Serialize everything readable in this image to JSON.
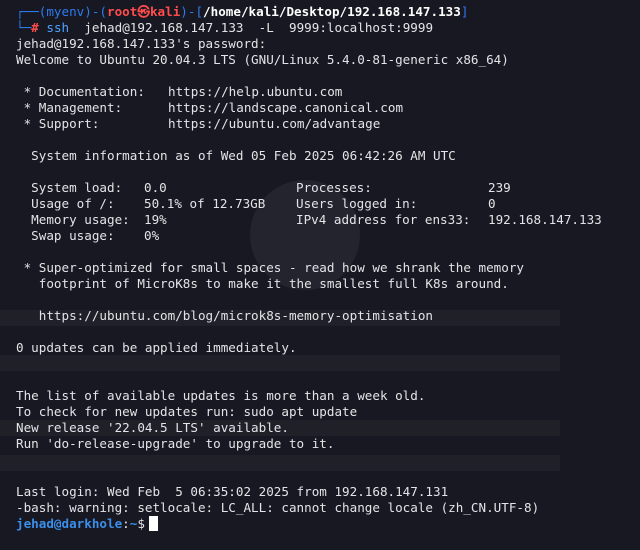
{
  "prompt": {
    "user": "root",
    "host": "kali",
    "skull": "㉿",
    "venv": "myenv",
    "cwd": "/home/kali/Desktop/192.168.147.133",
    "command": "ssh",
    "args": "jehad@192.168.147.133  -L  9999:localhost:9999"
  },
  "output": {
    "password_prompt": "jehad@192.168.147.133's password:",
    "welcome": "Welcome to Ubuntu 20.04.3 LTS (GNU/Linux 5.4.0-81-generic x86_64)",
    "links": [
      {
        "label": " * Documentation:",
        "url": "https://help.ubuntu.com"
      },
      {
        "label": " * Management:",
        "url": "https://landscape.canonical.com"
      },
      {
        "label": " * Support:",
        "url": "https://ubuntu.com/advantage"
      }
    ],
    "sysinfo_title": "  System information as of Wed 05 Feb 2025 06:42:26 AM UTC",
    "sysinfo": [
      {
        "k1": "  System load:",
        "v1": "0.0",
        "k2": "Processes:",
        "v2": "239"
      },
      {
        "k1": "  Usage of /:",
        "v1": "50.1% of 12.73GB",
        "k2": "Users logged in:",
        "v2": "0"
      },
      {
        "k1": "  Memory usage:",
        "v1": "19%",
        "k2": "IPv4 address for ens33:",
        "v2": "192.168.147.133"
      },
      {
        "k1": "  Swap usage:",
        "v1": "0%",
        "k2": "",
        "v2": ""
      }
    ],
    "microk8s_1": " * Super-optimized for small spaces - read how we shrank the memory",
    "microk8s_2": "   footprint of MicroK8s to make it the smallest full K8s around.",
    "microk8s_url": "   https://ubuntu.com/blog/microk8s-memory-optimisation",
    "updates": "0 updates can be applied immediately.",
    "list_old": "The list of available updates is more than a week old.",
    "check_updates": "To check for new updates run: sudo apt update",
    "new_release": "New release '22.04.5 LTS' available.",
    "run_upgrade": "Run 'do-release-upgrade' to upgrade to it.",
    "last_login": "Last login: Wed Feb  5 06:35:02 2025 from 192.168.147.131",
    "locale_warning": "-bash: warning: setlocale: LC_ALL: cannot change locale (zh_CN.UTF-8)"
  },
  "remote_prompt": {
    "user_host": "jehad@darkhole",
    "sep": ":",
    "path": "~",
    "symbol": "$"
  },
  "colors": {
    "background": "#171821",
    "text": "#e4e4e8",
    "prompt_blue": "#2e7bf0",
    "root_red": "#ff4d4d",
    "remote_user": "#3b8eea"
  }
}
